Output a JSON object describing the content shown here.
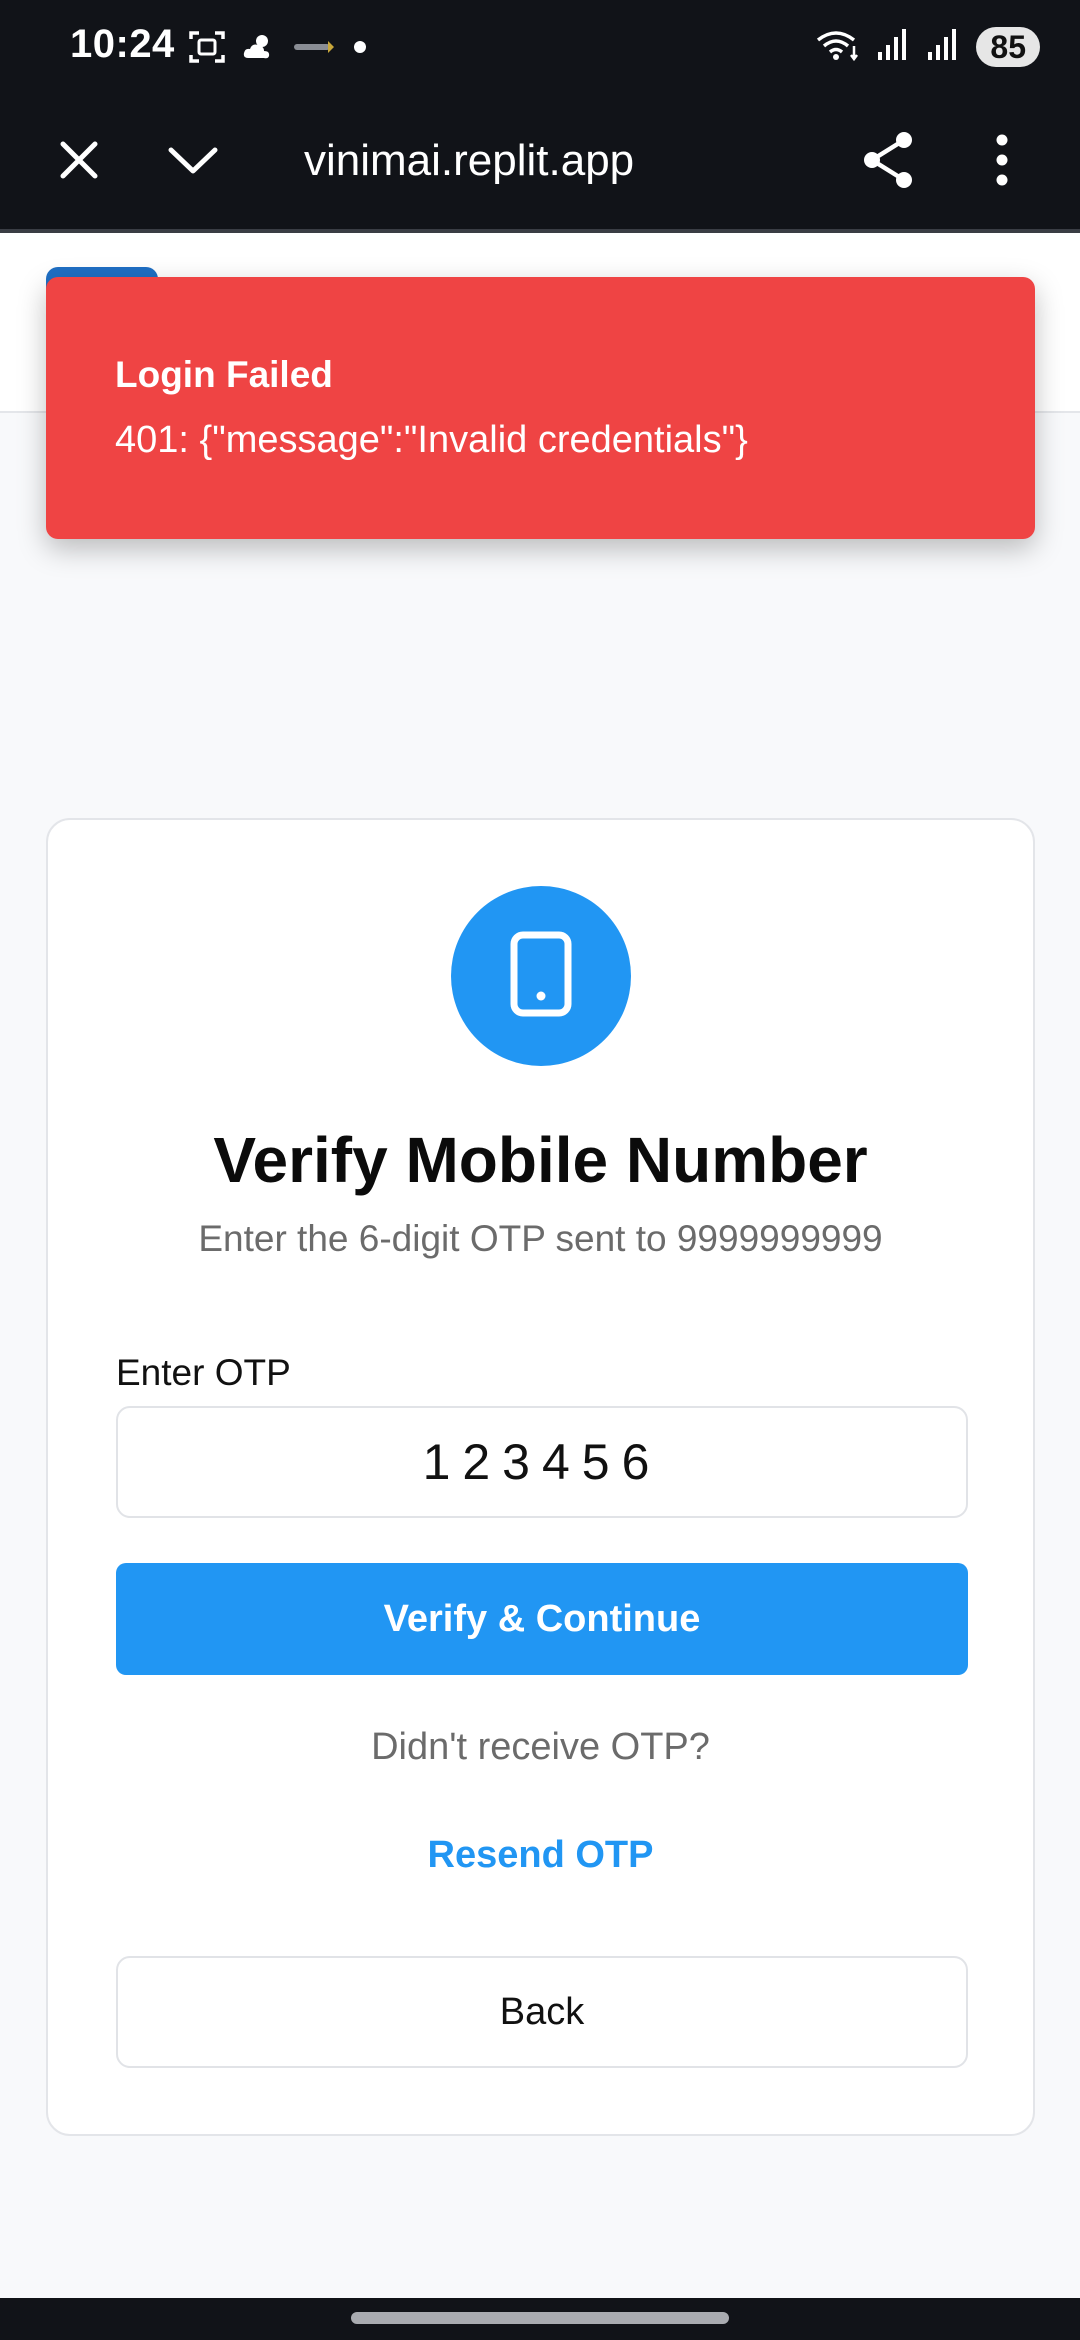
{
  "status_bar": {
    "time": "10:24",
    "battery": "85",
    "left_icons": [
      "screenshot-icon",
      "weather-icon",
      "notification-app-icon",
      "dot-icon"
    ],
    "right_icons": [
      "wifi-icon",
      "signal-icon",
      "signal-icon"
    ]
  },
  "browser": {
    "url": "vinimai.replit.app",
    "icons": [
      "close-icon",
      "chevron-down-icon",
      "share-icon",
      "more-vertical-icon"
    ]
  },
  "toast": {
    "title": "Login Failed",
    "message": "401: {\"message\":\"Invalid credentials\"}",
    "color": "#ef4444"
  },
  "card": {
    "icon": "smartphone-icon",
    "title": "Verify Mobile Number",
    "subtitle": "Enter the 6-digit OTP sent to 9999999999",
    "otp_label": "Enter OTP",
    "otp_value": "123456",
    "verify_label": "Verify & Continue",
    "didnt_receive": "Didn't receive OTP?",
    "resend_label": "Resend OTP",
    "back_label": "Back"
  },
  "colors": {
    "primary": "#2196f3",
    "error": "#ef4444",
    "background": "#f8f9fb",
    "bars": "#111318"
  }
}
